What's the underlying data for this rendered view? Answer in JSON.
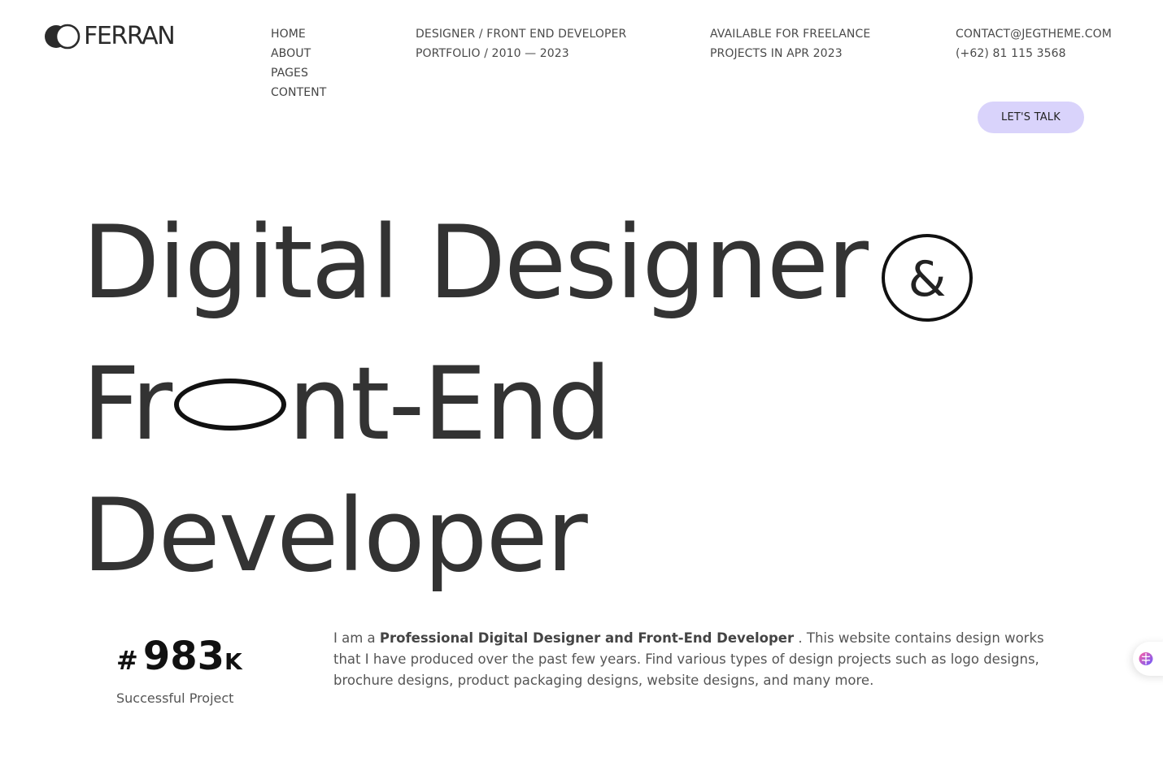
{
  "brand": {
    "name": "FERRAN"
  },
  "nav": [
    {
      "label": "HOME"
    },
    {
      "label": "ABOUT"
    },
    {
      "label": "PAGES"
    },
    {
      "label": "CONTENT"
    }
  ],
  "info": {
    "role_line1": "DESIGNER / FRONT END DEVELOPER",
    "role_line2": "PORTFOLIO / 2010 — 2023",
    "availability_line1": "AVAILABLE FOR FREELANCE",
    "availability_line2": "PROJECTS IN APR 2023",
    "email": "CONTACT@JEGTHEME.COM",
    "phone": "(+62) 81 115 3568"
  },
  "cta": {
    "label": "LET'S TALK"
  },
  "hero": {
    "line1": "Digital Designer",
    "ampersand": "&",
    "line2_start": "Fr",
    "line2_end": "nt-End",
    "line3": "Developer"
  },
  "stat": {
    "prefix": "#",
    "value": "983",
    "suffix": "K",
    "label": "Successful Project"
  },
  "about": {
    "intro": "I am a ",
    "highlight": "Professional Digital Designer and Front-End Developer",
    "rest": " . This website contains design works that I have produced over the past few years. Find various types of design projects such as logo designs, brochure designs, product packaging designs, website designs, and many more."
  },
  "colors": {
    "text": "#333333",
    "accent": "#d9d3fb",
    "dark": "#111111"
  },
  "icons": {
    "logo": "overlapping-circles-icon",
    "widget": "brain-icon"
  }
}
